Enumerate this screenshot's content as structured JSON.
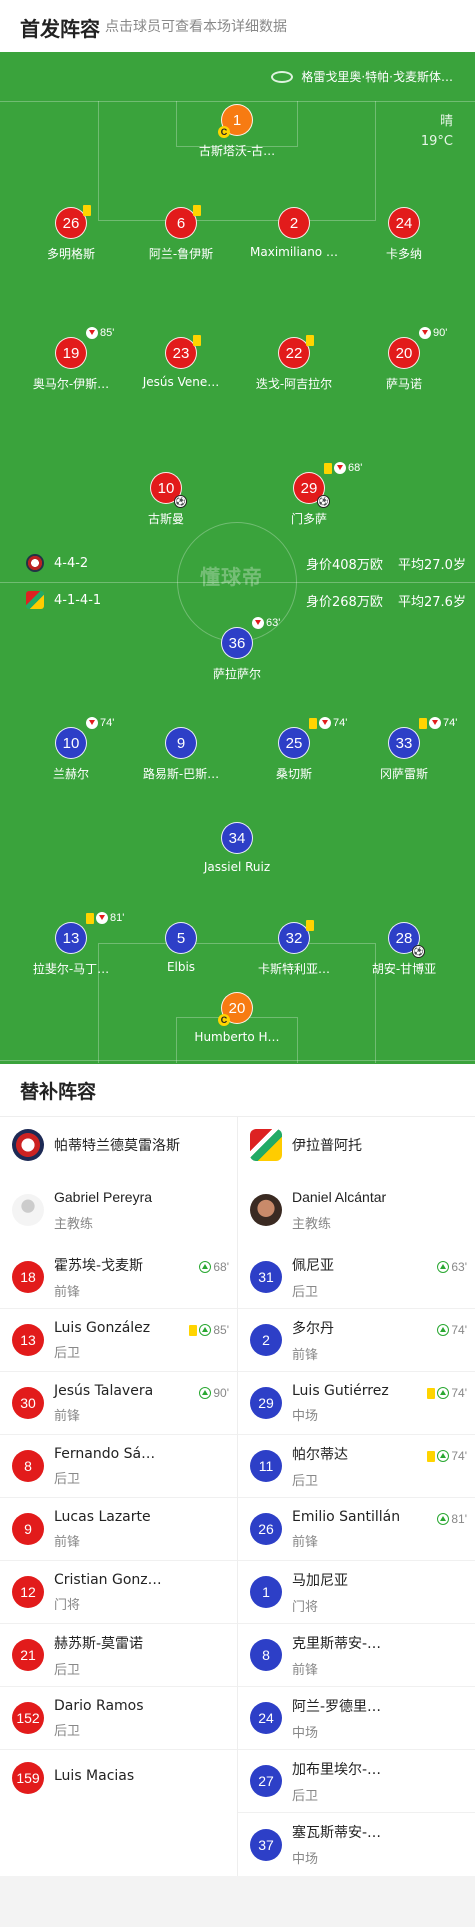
{
  "header": {
    "title": "首发阵容",
    "subtitle": "点击球员可查看本场详细数据"
  },
  "match": {
    "stadium": "格雷戈里奥·特帕·戈麦斯体…",
    "weather": "晴",
    "temp": "19°C",
    "watermark": "懂球帝"
  },
  "teams": {
    "home": {
      "formation": "4-4-2",
      "value": "身价408万欧",
      "age": "平均27.0岁",
      "name": "帕蒂特兰德莫雷洛斯"
    },
    "away": {
      "formation": "4-1-4-1",
      "value": "身价268万欧",
      "age": "平均27.6岁",
      "name": "伊拉普阿托"
    }
  },
  "home_players": [
    {
      "num": "1",
      "name": "古斯塔沃-古…",
      "captain": "C"
    },
    {
      "num": "26",
      "name": "多明格斯"
    },
    {
      "num": "6",
      "name": "阿兰-鲁伊斯"
    },
    {
      "num": "2",
      "name": "Maximiliano …"
    },
    {
      "num": "24",
      "name": "卡多纳"
    },
    {
      "num": "19",
      "name": "奥马尔-伊斯…",
      "min": "85'"
    },
    {
      "num": "23",
      "name": "Jesús Vene…"
    },
    {
      "num": "22",
      "name": "迭戈-阿吉拉尔"
    },
    {
      "num": "20",
      "name": "萨马诺",
      "min": "90'"
    },
    {
      "num": "10",
      "name": "古斯曼"
    },
    {
      "num": "29",
      "name": "门多萨",
      "min": "68'"
    }
  ],
  "away_players": [
    {
      "num": "36",
      "name": "萨拉萨尔",
      "min": "63'"
    },
    {
      "num": "10",
      "name": "兰赫尔",
      "min": "74'"
    },
    {
      "num": "9",
      "name": "路易斯-巴斯…"
    },
    {
      "num": "25",
      "name": "桑切斯",
      "min": "74'"
    },
    {
      "num": "33",
      "name": "冈萨雷斯",
      "min": "74'"
    },
    {
      "num": "34",
      "name": "Jassiel Ruiz"
    },
    {
      "num": "13",
      "name": "拉斐尔-马丁…",
      "min": "81'"
    },
    {
      "num": "5",
      "name": "Elbis"
    },
    {
      "num": "32",
      "name": "卡斯特利亚…"
    },
    {
      "num": "28",
      "name": "胡安-甘博亚"
    },
    {
      "num": "20",
      "name": "Humberto H…",
      "captain": "C"
    }
  ],
  "subs": {
    "title": "替补阵容",
    "coach_role": "主教练",
    "home": {
      "coach": "Gabriel Pereyra",
      "players": [
        {
          "num": "18",
          "name": "霍苏埃-戈麦斯",
          "pos": "前锋",
          "min": "68'"
        },
        {
          "num": "13",
          "name": "Luis González",
          "pos": "后卫",
          "min": "85'"
        },
        {
          "num": "30",
          "name": "Jesús Talavera",
          "pos": "前锋",
          "min": "90'"
        },
        {
          "num": "8",
          "name": "Fernando Sá…",
          "pos": "后卫"
        },
        {
          "num": "9",
          "name": "Lucas Lazarte",
          "pos": "前锋"
        },
        {
          "num": "12",
          "name": "Cristian Gonz…",
          "pos": "门将"
        },
        {
          "num": "21",
          "name": "赫苏斯-莫雷诺",
          "pos": "后卫"
        },
        {
          "num": "152",
          "name": "Dario Ramos",
          "pos": "后卫"
        },
        {
          "num": "159",
          "name": "Luis Macias",
          "pos": ""
        }
      ]
    },
    "away": {
      "coach": "Daniel Alcántar",
      "players": [
        {
          "num": "31",
          "name": "佩尼亚",
          "pos": "后卫",
          "min": "63'"
        },
        {
          "num": "2",
          "name": "多尔丹",
          "pos": "前锋",
          "min": "74'"
        },
        {
          "num": "29",
          "name": "Luis Gutiérrez",
          "pos": "中场",
          "min": "74'"
        },
        {
          "num": "11",
          "name": "帕尔蒂达",
          "pos": "后卫",
          "min": "74'"
        },
        {
          "num": "26",
          "name": "Emilio Santillán",
          "pos": "前锋",
          "min": "81'"
        },
        {
          "num": "1",
          "name": "马加尼亚",
          "pos": "门将"
        },
        {
          "num": "8",
          "name": "克里斯蒂安-…",
          "pos": "前锋"
        },
        {
          "num": "24",
          "name": "阿兰-罗德里…",
          "pos": "中场"
        },
        {
          "num": "27",
          "name": "加布里埃尔-…",
          "pos": "后卫"
        },
        {
          "num": "37",
          "name": "塞瓦斯蒂安-…",
          "pos": "中场"
        }
      ]
    }
  }
}
